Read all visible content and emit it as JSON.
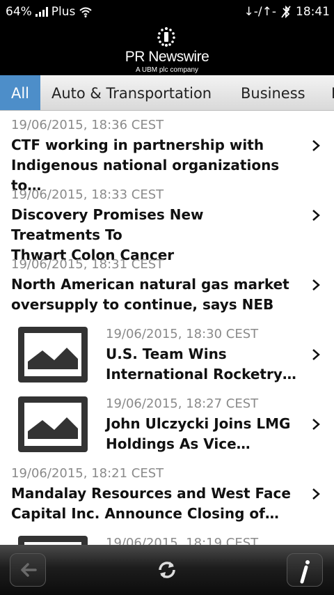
{
  "status_bar": {
    "battery": "64%",
    "carrier": "Plus",
    "data_indicator": "↓-/↑-",
    "time": "18:41",
    "icons": [
      "signal-bars-icon",
      "wifi-icon",
      "bluetooth-off-icon"
    ]
  },
  "header": {
    "logo_name": "PR Newswire",
    "logo_sub": "A UBM plc company"
  },
  "tabs": [
    {
      "label": "All",
      "selected": true
    },
    {
      "label": "Auto & Transportation",
      "selected": false
    },
    {
      "label": "Business",
      "selected": false
    },
    {
      "label": "I",
      "selected": false
    }
  ],
  "news": [
    {
      "date": "19/06/2015, 18:36 CEST",
      "title": "CTF working in partnership with\nIndigenous national organizations to…",
      "thumbnail": false
    },
    {
      "date": "19/06/2015, 18:33 CEST",
      "title": "Discovery Promises New Treatments To\nThwart Colon Cancer",
      "thumbnail": false
    },
    {
      "date": "19/06/2015, 18:31 CEST",
      "title": "North American natural gas market\noversupply to continue, says NEB",
      "thumbnail": false
    },
    {
      "date": "19/06/2015, 18:30 CEST",
      "title": "U.S. Team Wins\nInternational Rocketry…",
      "thumbnail": true
    },
    {
      "date": "19/06/2015, 18:27 CEST",
      "title": "John Ulczycki Joins LMG\nHoldings As Vice…",
      "thumbnail": true
    },
    {
      "date": "19/06/2015, 18:21 CEST",
      "title": "Mandalay Resources and West Face\nCapital Inc. Announce Closing of…",
      "thumbnail": false
    },
    {
      "date": "19/06/2015, 18:19 CEST",
      "title": "",
      "thumbnail": true
    }
  ],
  "toolbar": {
    "buttons": [
      "back-arrow-icon",
      "refresh-icon",
      "info-icon"
    ]
  },
  "colors": {
    "tab_selected_bg": "#4d8ec9",
    "header_bg": "#000000",
    "date_text": "#8a8a8a"
  }
}
